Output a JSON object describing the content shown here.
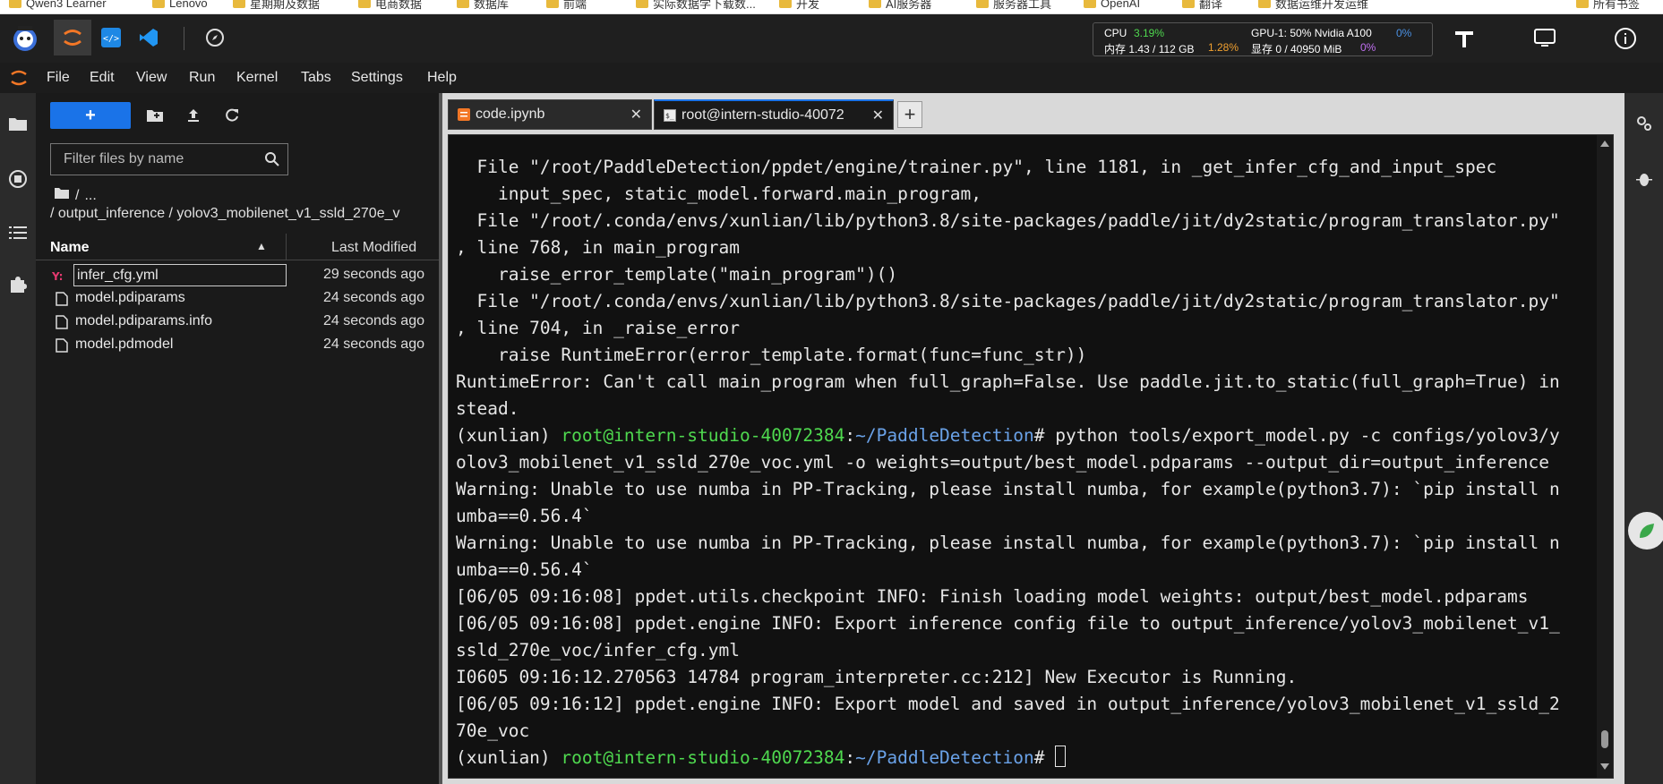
{
  "bookmarks": [
    {
      "label": "Qwen3 Learner"
    },
    {
      "label": "Lenovo"
    },
    {
      "label": "星期期及数据"
    },
    {
      "label": "电商数据"
    },
    {
      "label": "数据库"
    },
    {
      "label": "前端"
    },
    {
      "label": "实际数据学下载数..."
    },
    {
      "label": "开发"
    },
    {
      "label": "AI服务器"
    },
    {
      "label": "服务器工具"
    },
    {
      "label": "OpenAI"
    },
    {
      "label": "翻译"
    },
    {
      "label": "数据运维开发运维"
    },
    {
      "label": "所有书签"
    }
  ],
  "resource_monitor": {
    "cpu_label": "CPU",
    "cpu_value": "3.19%",
    "mem_label": "内存 1.43 / 112 GB",
    "mem_value": "1.28%",
    "gpu_label": "GPU-1: 50% Nvidia A100",
    "gpu_value": "0%",
    "vram_label": "显存 0 / 40950 MiB",
    "vram_value": "0%"
  },
  "menu": [
    "File",
    "Edit",
    "View",
    "Run",
    "Kernel",
    "Tabs",
    "Settings",
    "Help"
  ],
  "filebrowser": {
    "new_label": "+",
    "filter_placeholder": "Filter files by name",
    "crumb_root": "/",
    "crumb_more": "...",
    "path": "/ output_inference / yolov3_mobilenet_v1_ssld_270e_v",
    "col_name": "Name",
    "col_modified": "Last Modified",
    "files": [
      {
        "name": "infer_cfg.yml",
        "modified": "29 seconds ago",
        "icon": "yaml-icon",
        "selected": true
      },
      {
        "name": "model.pdiparams",
        "modified": "24 seconds ago",
        "icon": "file-icon"
      },
      {
        "name": "model.pdiparams.info",
        "modified": "24 seconds ago",
        "icon": "file-icon"
      },
      {
        "name": "model.pdmodel",
        "modified": "24 seconds ago",
        "icon": "file-icon"
      }
    ]
  },
  "tabs": [
    {
      "label": "code.ipynb",
      "icon": "notebook-icon"
    },
    {
      "label": "root@intern-studio-40072",
      "icon": "terminal-icon"
    }
  ],
  "terminal": {
    "lines": [
      "  File \"/root/PaddleDetection/ppdet/engine/trainer.py\", line 1181, in _get_infer_cfg_and_input_spec",
      "    input_spec, static_model.forward.main_program,",
      "  File \"/root/.conda/envs/xunlian/lib/python3.8/site-packages/paddle/jit/dy2static/program_translator.py\"",
      ", line 768, in main_program",
      "    raise_error_template(\"main_program\")()",
      "  File \"/root/.conda/envs/xunlian/lib/python3.8/site-packages/paddle/jit/dy2static/program_translator.py\"",
      ", line 704, in _raise_error",
      "    raise RuntimeError(error_template.format(func=func_str))",
      "RuntimeError: Can't call main_program when full_graph=False. Use paddle.jit.to_static(full_graph=True) in",
      "stead.",
      "PROMPT1",
      "olov3_mobilenet_v1_ssld_270e_voc.yml -o weights=output/best_model.pdparams --output_dir=output_inference",
      "Warning: Unable to use numba in PP-Tracking, please install numba, for example(python3.7): `pip install n",
      "umba==0.56.4`",
      "Warning: Unable to use numba in PP-Tracking, please install numba, for example(python3.7): `pip install n",
      "umba==0.56.4`",
      "[06/05 09:16:08] ppdet.utils.checkpoint INFO: Finish loading model weights: output/best_model.pdparams",
      "[06/05 09:16:08] ppdet.engine INFO: Export inference config file to output_inference/yolov3_mobilenet_v1_",
      "ssld_270e_voc/infer_cfg.yml",
      "I0605 09:16:12.270563 14784 program_interpreter.cc:212] New Executor is Running.",
      "[06/05 09:16:12] ppdet.engine INFO: Export model and saved in output_inference/yolov3_mobilenet_v1_ssld_2",
      "70e_voc",
      "PROMPT2"
    ],
    "prompt_env": "(xunlian) ",
    "prompt_user": "root@intern-studio-40072384",
    "prompt_sep": ":",
    "prompt_path": "~/PaddleDetection",
    "prompt_hash": "# ",
    "command1": "python tools/export_model.py -c configs/yolov3/y"
  }
}
